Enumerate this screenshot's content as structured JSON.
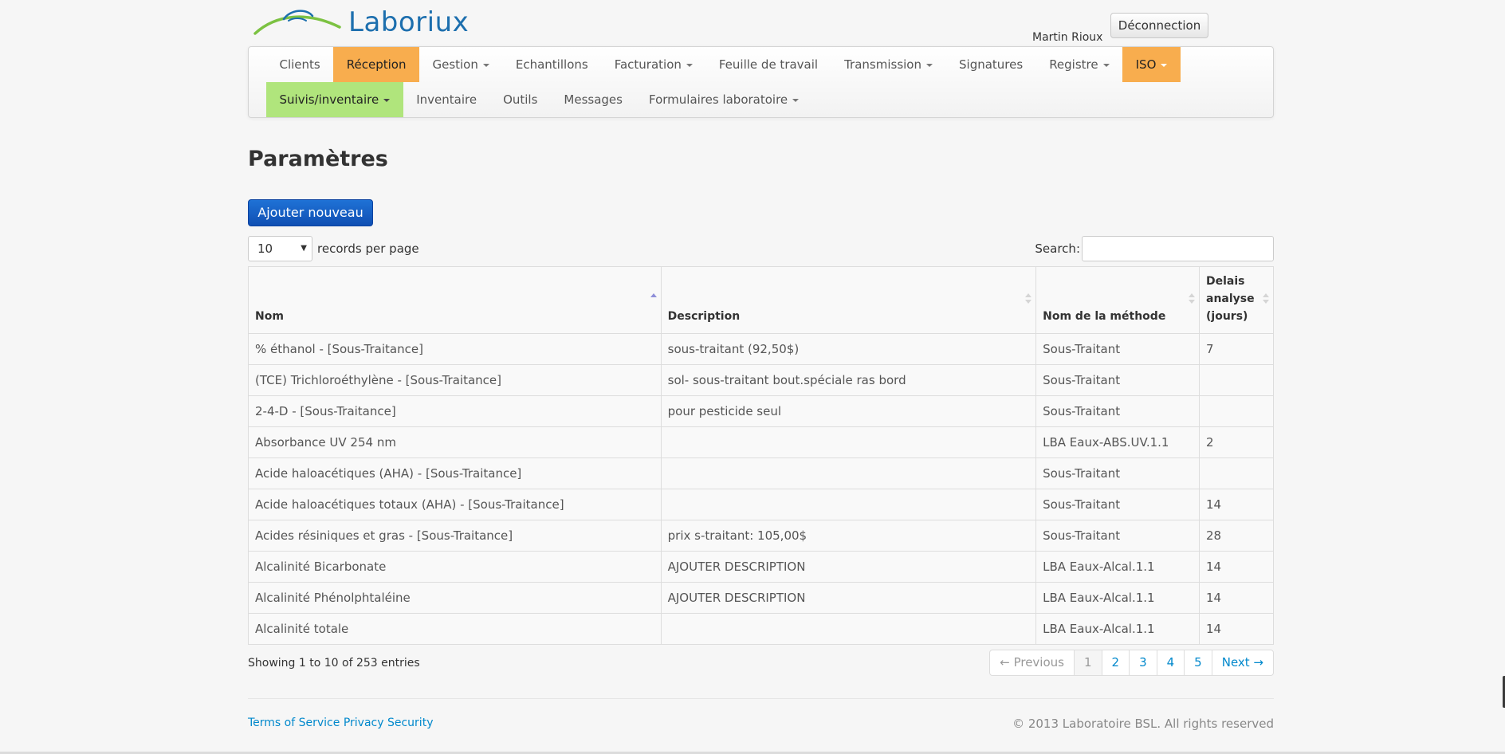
{
  "header": {
    "brand": "Laboriux",
    "user_name": "Martin Rioux",
    "logout_label": "Déconnection"
  },
  "nav": {
    "row1": [
      {
        "label": "Clients",
        "dropdown": false,
        "highlight": ""
      },
      {
        "label": "Réception",
        "dropdown": false,
        "highlight": "orange"
      },
      {
        "label": "Gestion",
        "dropdown": true,
        "highlight": ""
      },
      {
        "label": "Echantillons",
        "dropdown": false,
        "highlight": ""
      },
      {
        "label": "Facturation",
        "dropdown": true,
        "highlight": ""
      },
      {
        "label": "Feuille de travail",
        "dropdown": false,
        "highlight": ""
      },
      {
        "label": "Transmission",
        "dropdown": true,
        "highlight": ""
      },
      {
        "label": "Signatures",
        "dropdown": false,
        "highlight": ""
      },
      {
        "label": "Registre",
        "dropdown": true,
        "highlight": ""
      },
      {
        "label": "ISO",
        "dropdown": true,
        "highlight": "orange"
      }
    ],
    "row2": [
      {
        "label": "Suivis/inventaire",
        "dropdown": true,
        "highlight": "green"
      },
      {
        "label": "Inventaire",
        "dropdown": false,
        "highlight": ""
      },
      {
        "label": "Outils",
        "dropdown": false,
        "highlight": ""
      },
      {
        "label": "Messages",
        "dropdown": false,
        "highlight": ""
      },
      {
        "label": "Formulaires laboratoire",
        "dropdown": true,
        "highlight": ""
      }
    ]
  },
  "page": {
    "title": "Paramètres",
    "add_button": "Ajouter nouveau"
  },
  "table_controls": {
    "records_value": "10",
    "records_label": "records per page",
    "search_label": "Search:",
    "search_value": ""
  },
  "table": {
    "columns": [
      "Nom",
      "Description",
      "Nom de la méthode",
      "Delais analyse (jours)"
    ],
    "sorted_column": 0,
    "rows": [
      [
        "% éthanol - [Sous-Traitance]",
        "sous-traitant (92,50$)",
        "Sous-Traitant",
        "7"
      ],
      [
        "(TCE) Trichloroéthylène - [Sous-Traitance]",
        "sol- sous-traitant bout.spéciale ras bord",
        "Sous-Traitant",
        ""
      ],
      [
        "2-4-D - [Sous-Traitance]",
        "pour pesticide seul",
        "Sous-Traitant",
        ""
      ],
      [
        "Absorbance UV 254 nm",
        "",
        "LBA Eaux-ABS.UV.1.1",
        "2"
      ],
      [
        "Acide haloacétiques (AHA) - [Sous-Traitance]",
        "",
        "Sous-Traitant",
        ""
      ],
      [
        "Acide haloacétiques totaux (AHA) - [Sous-Traitance]",
        "",
        "Sous-Traitant",
        "14"
      ],
      [
        "Acides résiniques et gras - [Sous-Traitance]",
        "prix s-traitant: 105,00$",
        "Sous-Traitant",
        "28"
      ],
      [
        "Alcalinité Bicarbonate",
        "AJOUTER DESCRIPTION",
        "LBA Eaux-Alcal.1.1",
        "14"
      ],
      [
        "Alcalinité Phénolphtaléine",
        "AJOUTER DESCRIPTION",
        "LBA Eaux-Alcal.1.1",
        "14"
      ],
      [
        "Alcalinité totale",
        "",
        "LBA Eaux-Alcal.1.1",
        "14"
      ]
    ]
  },
  "pagination": {
    "info": "Showing 1 to 10 of 253 entries",
    "previous": "← Previous",
    "pages": [
      "1",
      "2",
      "3",
      "4",
      "5"
    ],
    "current": "1",
    "next": "Next →"
  },
  "footer": {
    "links": [
      "Terms of Service",
      "Privacy",
      "Security"
    ],
    "copyright": "© 2013 Laboratoire BSL. All rights reserved"
  },
  "colors": {
    "orange_highlight": "#f8ad4e",
    "green_highlight": "#b0e57c",
    "primary_button": "#1565c8",
    "brand_blue": "#1d6fae",
    "link": "#0088cc"
  }
}
